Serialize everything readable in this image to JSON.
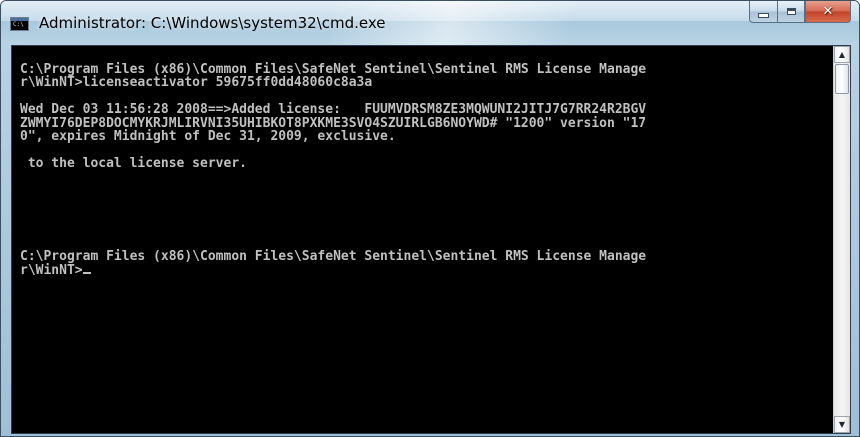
{
  "window": {
    "title": "Administrator: C:\\Windows\\system32\\cmd.exe",
    "icon": "console-icon",
    "icon_glyph": "C:\\"
  },
  "caption_buttons": {
    "minimize": "minimize-icon",
    "maximize": "maximize-icon",
    "close": "close-icon",
    "close_glyph": "✕"
  },
  "console": {
    "lines": [
      "C:\\Program Files (x86)\\Common Files\\SafeNet Sentinel\\Sentinel RMS License Manage",
      "r\\WinNT>licenseactivator 59675ff0dd48060c8a3a",
      "",
      "Wed Dec 03 11:56:28 2008==>Added license:   FUUMVDRSM8ZE3MQWUNI2JITJ7G7RR24R2BGV",
      "ZWMYI76DEP8DOCMYKRJMLIRVNI35UHIBKOT8PXKME3SVO4SZUIRLGB6NOYWD# \"1200\" version \"17",
      "0\", expires Midnight of Dec 31, 2009, exclusive.",
      "",
      " to the local license server.",
      "",
      "",
      "",
      "",
      "",
      "",
      "C:\\Program Files (x86)\\Common Files\\SafeNet Sentinel\\Sentinel RMS License Manage"
    ],
    "prompt_line": "r\\WinNT>",
    "text_color": "#c0c0c0",
    "background": "#000000"
  },
  "scrollbar": {
    "up_arrow": "▲",
    "down_arrow": "▼"
  }
}
